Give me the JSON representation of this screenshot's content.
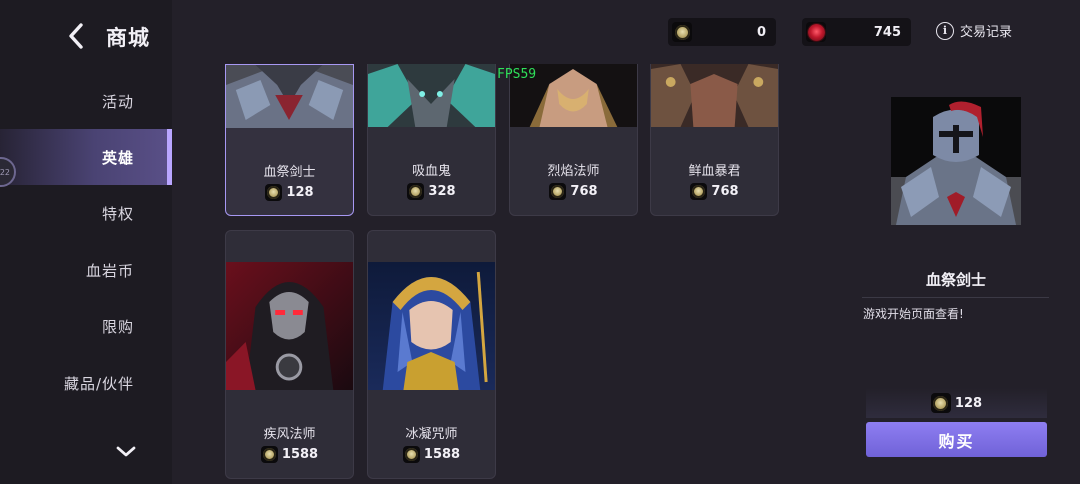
{
  "header": {
    "title": "商城",
    "currencies": [
      {
        "icon": "gold-coin-icon",
        "value": "0"
      },
      {
        "icon": "blood-gem-icon",
        "value": "745"
      }
    ],
    "history_label": "交易记录"
  },
  "sidebar": {
    "items": [
      {
        "label": "活动",
        "active": false
      },
      {
        "label": "英雄",
        "active": true
      },
      {
        "label": "特权",
        "active": false
      },
      {
        "label": "血岩币",
        "active": false
      },
      {
        "label": "限购",
        "active": false
      },
      {
        "label": "藏品/伙伴",
        "active": false
      }
    ],
    "handle_text": "22"
  },
  "overlay": {
    "fps": "FPS59"
  },
  "heroes": [
    {
      "name": "血祭剑士",
      "price": "128",
      "selected": true
    },
    {
      "name": "吸血鬼",
      "price": "328",
      "selected": false
    },
    {
      "name": "烈焰法师",
      "price": "768",
      "selected": false
    },
    {
      "name": "鲜血暴君",
      "price": "768",
      "selected": false
    },
    {
      "name": "疾风法师",
      "price": "1588",
      "selected": false
    },
    {
      "name": "冰凝咒师",
      "price": "1588",
      "selected": false
    }
  ],
  "detail": {
    "name": "血祭剑士",
    "description": "游戏开始页面查看!",
    "price": "128",
    "buy_label": "购买"
  },
  "colors": {
    "accent": "#8e7ef1",
    "sidebar_active": "#4a4373",
    "fps": "#2fe05a"
  }
}
